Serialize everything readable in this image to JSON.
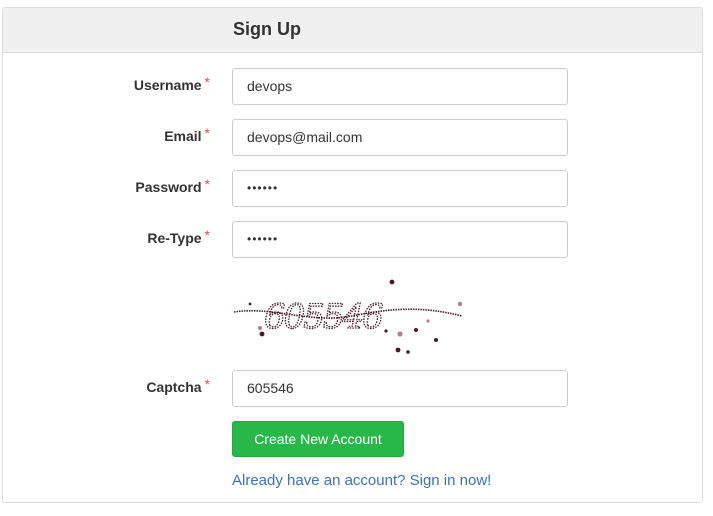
{
  "panel": {
    "title": "Sign Up"
  },
  "form": {
    "required_mark": "*",
    "username": {
      "label": "Username",
      "value": "devops"
    },
    "email": {
      "label": "Email",
      "value": "devops@mail.com"
    },
    "password": {
      "label": "Password",
      "value": "••••••"
    },
    "retype": {
      "label": "Re-Type",
      "value": "••••••"
    },
    "captcha_image": {
      "text": "605546",
      "color": "#4a1a2a"
    },
    "captcha": {
      "label": "Captcha",
      "value": "605546"
    },
    "submit_label": "Create New Account",
    "signin_link": "Already have an account? Sign in now!"
  },
  "colors": {
    "button": "#28b84a",
    "link": "#3a72b5",
    "required": "#d9534f",
    "heading_bg": "#f0f0f0"
  }
}
